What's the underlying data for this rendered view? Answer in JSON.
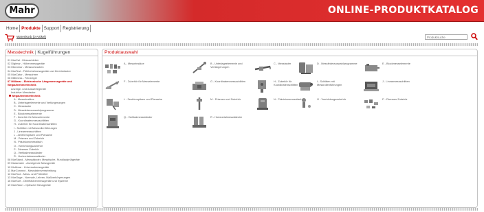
{
  "header": {
    "logo_text": "Mahr",
    "catalog_title": "ONLINE-PRODUKTKATALOG"
  },
  "nav": {
    "items": [
      {
        "label": "Home",
        "active": false
      },
      {
        "label": "Produkte",
        "active": true
      },
      {
        "label": "Support",
        "active": false
      },
      {
        "label": "Registrierung",
        "active": false
      }
    ]
  },
  "toolbar": {
    "cart_label": "Warenkorb (0 Artikel)",
    "search_placeholder": "Produktsuche"
  },
  "left_panel": {
    "title": "Messtechnik",
    "separator": "|",
    "subtitle": "Kugelführungen",
    "tree": [
      {
        "label": "01 MarCal - Messschieber",
        "level": 0,
        "red": false,
        "dot": false
      },
      {
        "label": "02 Digimar - Höhenmessgeräte",
        "level": 0,
        "red": false,
        "dot": false
      },
      {
        "label": "03 Micromar - Messschrauben",
        "level": 0,
        "red": false,
        "dot": false
      },
      {
        "label": "04 MarTest - Fühlhebelmessgeräte und Zentriertaster",
        "level": 0,
        "red": false,
        "dot": false
      },
      {
        "label": "05 MarCator - Messuhren",
        "level": 0,
        "red": false,
        "dot": false
      },
      {
        "label": "06 Millimess - Feinzeiger",
        "level": 0,
        "red": false,
        "dot": false
      },
      {
        "label": "07 Millimar - Elektronische Längenmessgeräte und",
        "level": 0,
        "red": true,
        "dot": false
      },
      {
        "label": "Wegaufnehmertechnik",
        "level": 0,
        "red": true,
        "dot": false
      },
      {
        "label": "Anzeige- und Auswertegeräte",
        "level": 1,
        "red": false,
        "dot": false
      },
      {
        "label": "Induktive Messtaster",
        "level": 1,
        "red": false,
        "dot": false
      },
      {
        "label": "Wegaufnehmertechnik",
        "level": 1,
        "red": true,
        "dot": true
      },
      {
        "label": "A - Messeinsätze",
        "level": 2,
        "red": false,
        "dot": false
      },
      {
        "label": "B - Unterlageelemente und Verlängerungen",
        "level": 2,
        "red": false,
        "dot": false
      },
      {
        "label": "C - Messtaster",
        "level": 2,
        "red": false,
        "dot": false
      },
      {
        "label": "D - Messfederauswahlprogramme",
        "level": 2,
        "red": false,
        "dot": false
      },
      {
        "label": "E - Blockmesselemente",
        "level": 2,
        "red": false,
        "dot": false
      },
      {
        "label": "F - Zubehör für Messelemente",
        "level": 2,
        "red": false,
        "dot": false
      },
      {
        "label": "G - Koordinatenmessschlitten",
        "level": 2,
        "red": false,
        "dot": false
      },
      {
        "label": "H - Zubehör für Koordinatenschlitten",
        "level": 2,
        "red": false,
        "dot": false
      },
      {
        "label": "I - Schlitten mit Messrollenführungen",
        "level": 2,
        "red": false,
        "dot": false
      },
      {
        "label": "J - Linearmessschlitten",
        "level": 2,
        "red": false,
        "dot": false
      },
      {
        "label": "L - Zentrierspitzen und Planache",
        "level": 2,
        "red": false,
        "dot": false
      },
      {
        "label": "M - Prismen und Zubehör",
        "level": 2,
        "red": false,
        "dot": false
      },
      {
        "label": "N - Präzisionsmesstisch",
        "level": 2,
        "red": false,
        "dot": false
      },
      {
        "label": "O - Vorrichtungszubehör",
        "level": 2,
        "red": false,
        "dot": false
      },
      {
        "label": "P - Diverses Zubehör",
        "level": 2,
        "red": false,
        "dot": false
      },
      {
        "label": "Q - Vertikalmessständer",
        "level": 2,
        "red": false,
        "dot": false
      },
      {
        "label": "R - Horizontalmessständer",
        "level": 2,
        "red": false,
        "dot": false
      },
      {
        "label": "08 MarStand - Messständer, Messtische, Rundlaufprüfgeräte",
        "level": 0,
        "red": false,
        "dot": false
      },
      {
        "label": "09 Maramster - Anzeigende Messgeräte",
        "level": 0,
        "red": false,
        "dot": false
      },
      {
        "label": "10 Multimar - Universalmessgeräte",
        "level": 0,
        "red": false,
        "dot": false
      },
      {
        "label": "11 MarConnect - Messdatenverarbeitung",
        "level": 0,
        "red": false,
        "dot": false
      },
      {
        "label": "12 MarTool - Mess- und Prüfmittel",
        "level": 0,
        "red": false,
        "dot": false
      },
      {
        "label": "13 MarGage - Normale, Lehren, Maßverkörperungen",
        "level": 0,
        "red": false,
        "dot": false
      },
      {
        "label": "16 MarSurf - Oberflächenmessgeräte und Systeme",
        "level": 0,
        "red": false,
        "dot": false
      },
      {
        "label": "19 MarVision - Optische Messgeräte",
        "level": 0,
        "red": false,
        "dot": false
      }
    ]
  },
  "right_panel": {
    "title": "Produktauswahl",
    "products": [
      {
        "label": "A - Messeinsätze",
        "icon": "measuring-insert-icon"
      },
      {
        "label": "B - Unterlageelemente und Verlängerungen",
        "icon": "extension-element-icon"
      },
      {
        "label": "C - Messtaster",
        "icon": "probe-icon"
      },
      {
        "label": "D - Messfederauswahlprogramme",
        "icon": "spring-set-icon"
      },
      {
        "label": "E - Blockmesselemente",
        "icon": "block-element-icon"
      },
      {
        "label": "F - Zubehör für Messelemente",
        "icon": "element-accessory-icon"
      },
      {
        "label": "G - Koordinatenmessschlitten",
        "icon": "coordinate-slide-icon"
      },
      {
        "label": "H - Zubehör für Koordinatenschlitten",
        "icon": "slide-accessory-icon"
      },
      {
        "label": "I - Schlitten mit Messrollenführungen",
        "icon": "roller-slide-icon"
      },
      {
        "label": "J - Linearmessschlitten",
        "icon": "linear-slide-icon"
      },
      {
        "label": "L - Zentrierspitzen und Planache",
        "icon": "centre-point-icon"
      },
      {
        "label": "M - Prismen und Zubehör",
        "icon": "prism-icon"
      },
      {
        "label": "N - Präzisionsmesstisch",
        "icon": "measuring-table-icon"
      },
      {
        "label": "O - Vorrichtungszubehör",
        "icon": "fixture-accessory-icon"
      },
      {
        "label": "P - Diverses Zubehör",
        "icon": "misc-accessory-icon"
      },
      {
        "label": "Q - Vertikalmessständer",
        "icon": "vertical-stand-icon"
      },
      {
        "label": "R - Horizontalmessständer",
        "icon": "horizontal-stand-icon"
      }
    ]
  },
  "colors": {
    "brand_red": "#d42a2a",
    "active_red": "#cc0000",
    "border_grey": "#c4c4c4"
  }
}
